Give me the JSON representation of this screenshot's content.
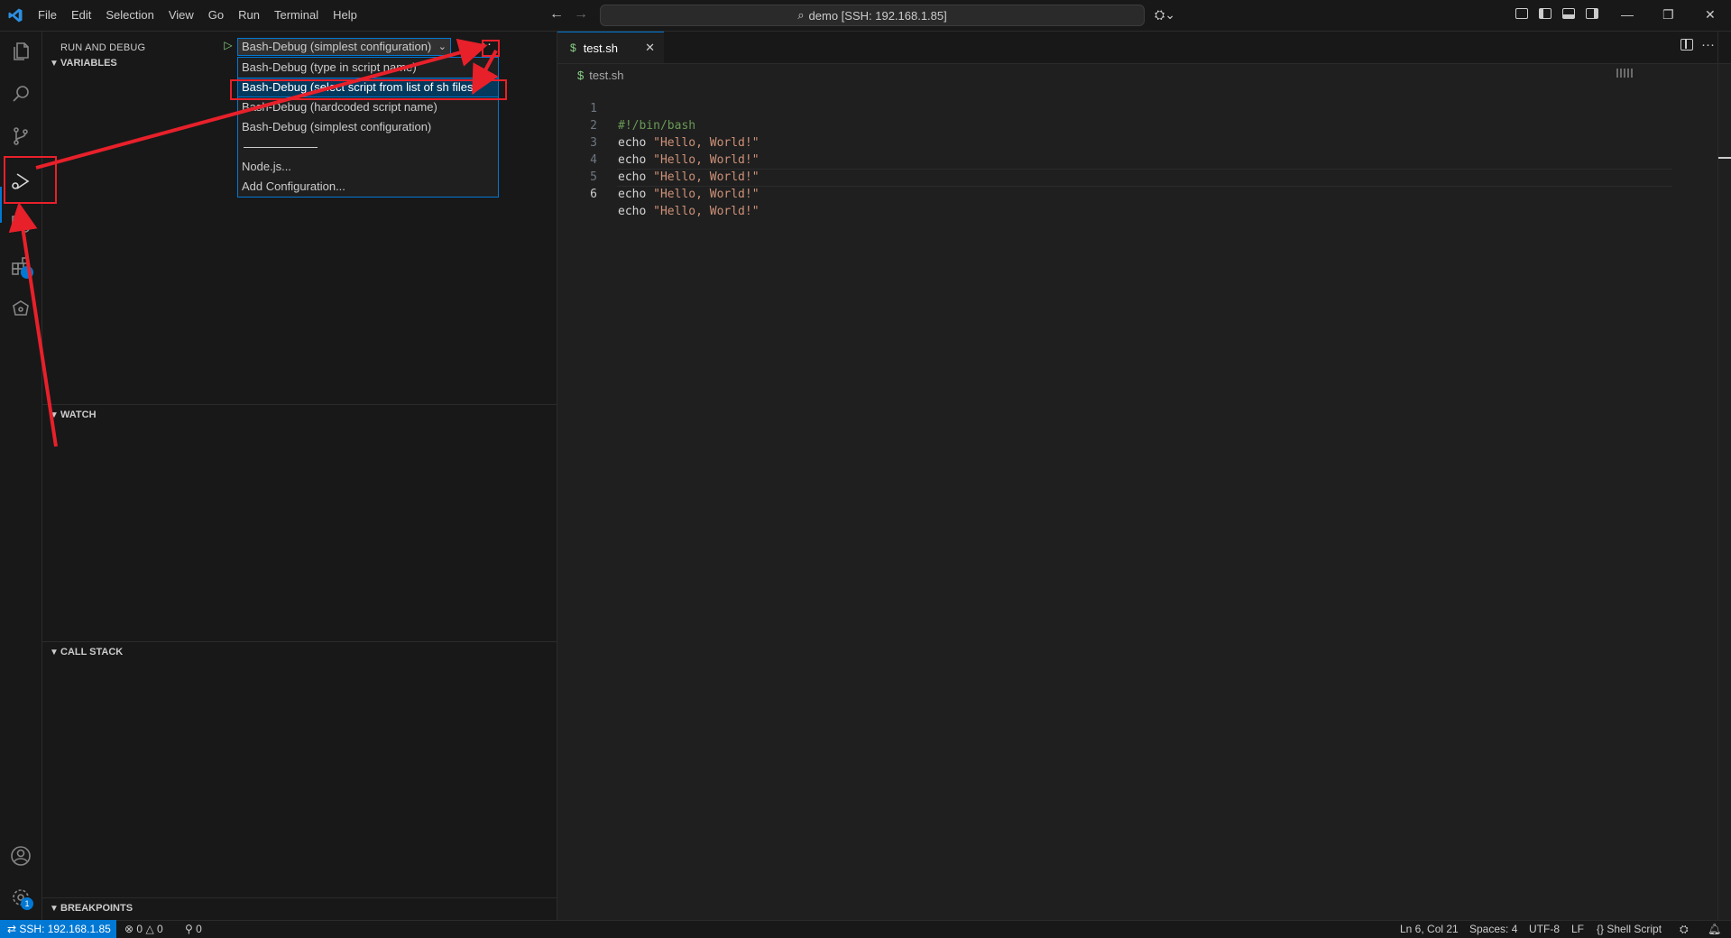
{
  "titlebar": {
    "menu": [
      "File",
      "Edit",
      "Selection",
      "View",
      "Go",
      "Run",
      "Terminal",
      "Help"
    ],
    "command_center": "demo [SSH: 192.168.1.85]"
  },
  "sidebar": {
    "title": "RUN AND DEBUG",
    "selected_config": "Bash-Debug (simplest configuration)",
    "dropdown": [
      "Bash-Debug (type in script name)",
      "Bash-Debug (select script from list of sh files)",
      "Bash-Debug (hardcoded script name)",
      "Bash-Debug (simplest configuration)",
      "Node.js...",
      "Add Configuration..."
    ],
    "dropdown_selected_index": 1,
    "sections": {
      "variables": "VARIABLES",
      "watch": "WATCH",
      "call_stack": "CALL STACK",
      "breakpoints": "BREAKPOINTS"
    }
  },
  "activitybar": {
    "icons": [
      "files-icon",
      "search-icon",
      "source-control-icon",
      "run-debug-icon",
      "remote-explorer-icon",
      "extensions-icon",
      "kubernetes-icon",
      "account-icon",
      "manage-gear-icon"
    ],
    "manage_badge": "1"
  },
  "editor": {
    "tab_label": "test.sh",
    "tab_icon": "$",
    "breadcrumb": "test.sh",
    "lines": [
      {
        "n": "1",
        "text": "#!/bin/bash"
      },
      {
        "n": "2",
        "cmd": "echo",
        "str": "\"Hello, World!\""
      },
      {
        "n": "3",
        "cmd": "echo",
        "str": "\"Hello, World!\""
      },
      {
        "n": "4",
        "cmd": "echo",
        "str": "\"Hello, World!\""
      },
      {
        "n": "5",
        "cmd": "echo",
        "str": "\"Hello, World!\""
      },
      {
        "n": "6",
        "cmd": "echo",
        "str": "\"Hello, World!\""
      }
    ],
    "current_line": "6"
  },
  "statusbar": {
    "remote": "SSH: 192.168.1.85",
    "errors": "0",
    "warnings": "0",
    "ports": "0",
    "position": "Ln 6, Col 21",
    "spaces": "Spaces: 4",
    "encoding": "UTF-8",
    "eol": "LF",
    "language": "Shell Script"
  },
  "colors": {
    "accent": "#0078d4",
    "annotation": "#e8202a"
  }
}
